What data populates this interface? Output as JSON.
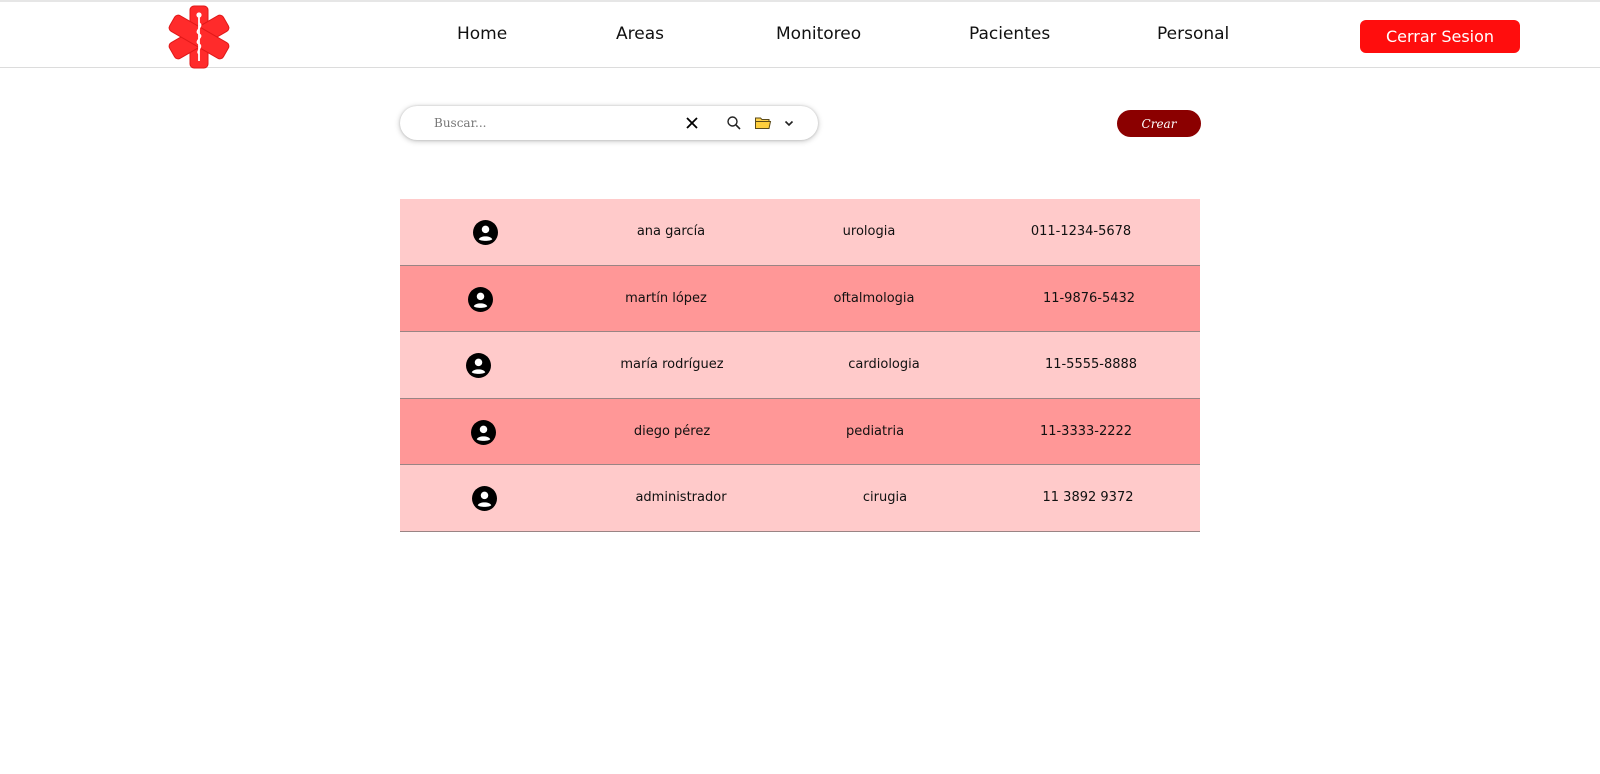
{
  "header": {
    "nav": [
      {
        "label": "Home",
        "name": "nav-home"
      },
      {
        "label": "Areas",
        "name": "nav-areas"
      },
      {
        "label": "Monitoreo",
        "name": "nav-monitoreo"
      },
      {
        "label": "Pacientes",
        "name": "nav-pacientes"
      },
      {
        "label": "Personal",
        "name": "nav-personal"
      }
    ],
    "logout_label": "Cerrar Sesion"
  },
  "search": {
    "placeholder": "Buscar...",
    "value": ""
  },
  "create_label": "Crear",
  "icons": {
    "logo": "star-of-life-icon",
    "clear": "close-icon",
    "search": "search-icon",
    "folder": "folder-icon",
    "dropdown": "chevron-down-icon",
    "avatar": "user-circle-icon"
  },
  "colors": {
    "logout": "#ff0d0d",
    "create": "#8b0000",
    "row_light": "#ffcaca",
    "row_dark": "#ff9797",
    "logo": "#ff2b2b"
  },
  "staff": [
    {
      "name": "ana garcía",
      "area": "urologia",
      "phone": "011-1234-5678"
    },
    {
      "name": "martín lópez",
      "area": "oftalmologia",
      "phone": "11-9876-5432"
    },
    {
      "name": "maría rodríguez",
      "area": "cardiologia",
      "phone": "11-5555-8888"
    },
    {
      "name": "diego pérez",
      "area": "pediatria",
      "phone": "11-3333-2222"
    },
    {
      "name": "administrador",
      "area": "cirugia",
      "phone": "11 3892 9372"
    }
  ]
}
